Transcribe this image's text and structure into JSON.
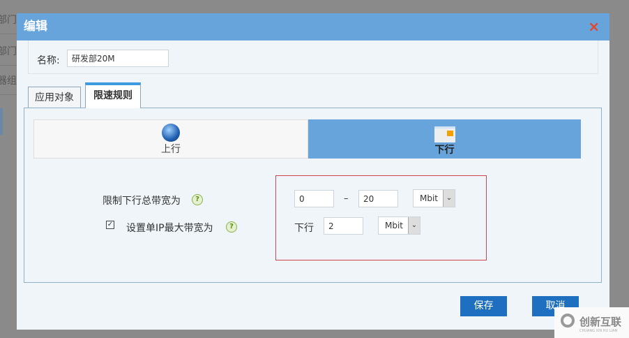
{
  "background_rows": [
    "务部门",
    "发部门",
    "器组"
  ],
  "dialog": {
    "title": "编辑",
    "close": "×"
  },
  "name": {
    "label": "名称:",
    "value": "研发部20M"
  },
  "tabs": [
    {
      "label": "应用对象"
    },
    {
      "label": "限速规则"
    }
  ],
  "direction": {
    "up": "上行",
    "down": "下行"
  },
  "rules": {
    "total_label": "限制下行总带宽为",
    "total_min": "0",
    "sep": "–",
    "total_max": "20",
    "total_unit": "Mbit",
    "per_ip_label": "设置单IP最大带宽为",
    "per_ip_checked": true,
    "per_ip_dir": "下行",
    "per_ip_value": "2",
    "per_ip_unit": "Mbit",
    "help": "?"
  },
  "buttons": {
    "save": "保存",
    "cancel": "取消"
  },
  "watermark": {
    "text": "创新互联",
    "sub": "CHUANG XIN HU LIAN"
  }
}
